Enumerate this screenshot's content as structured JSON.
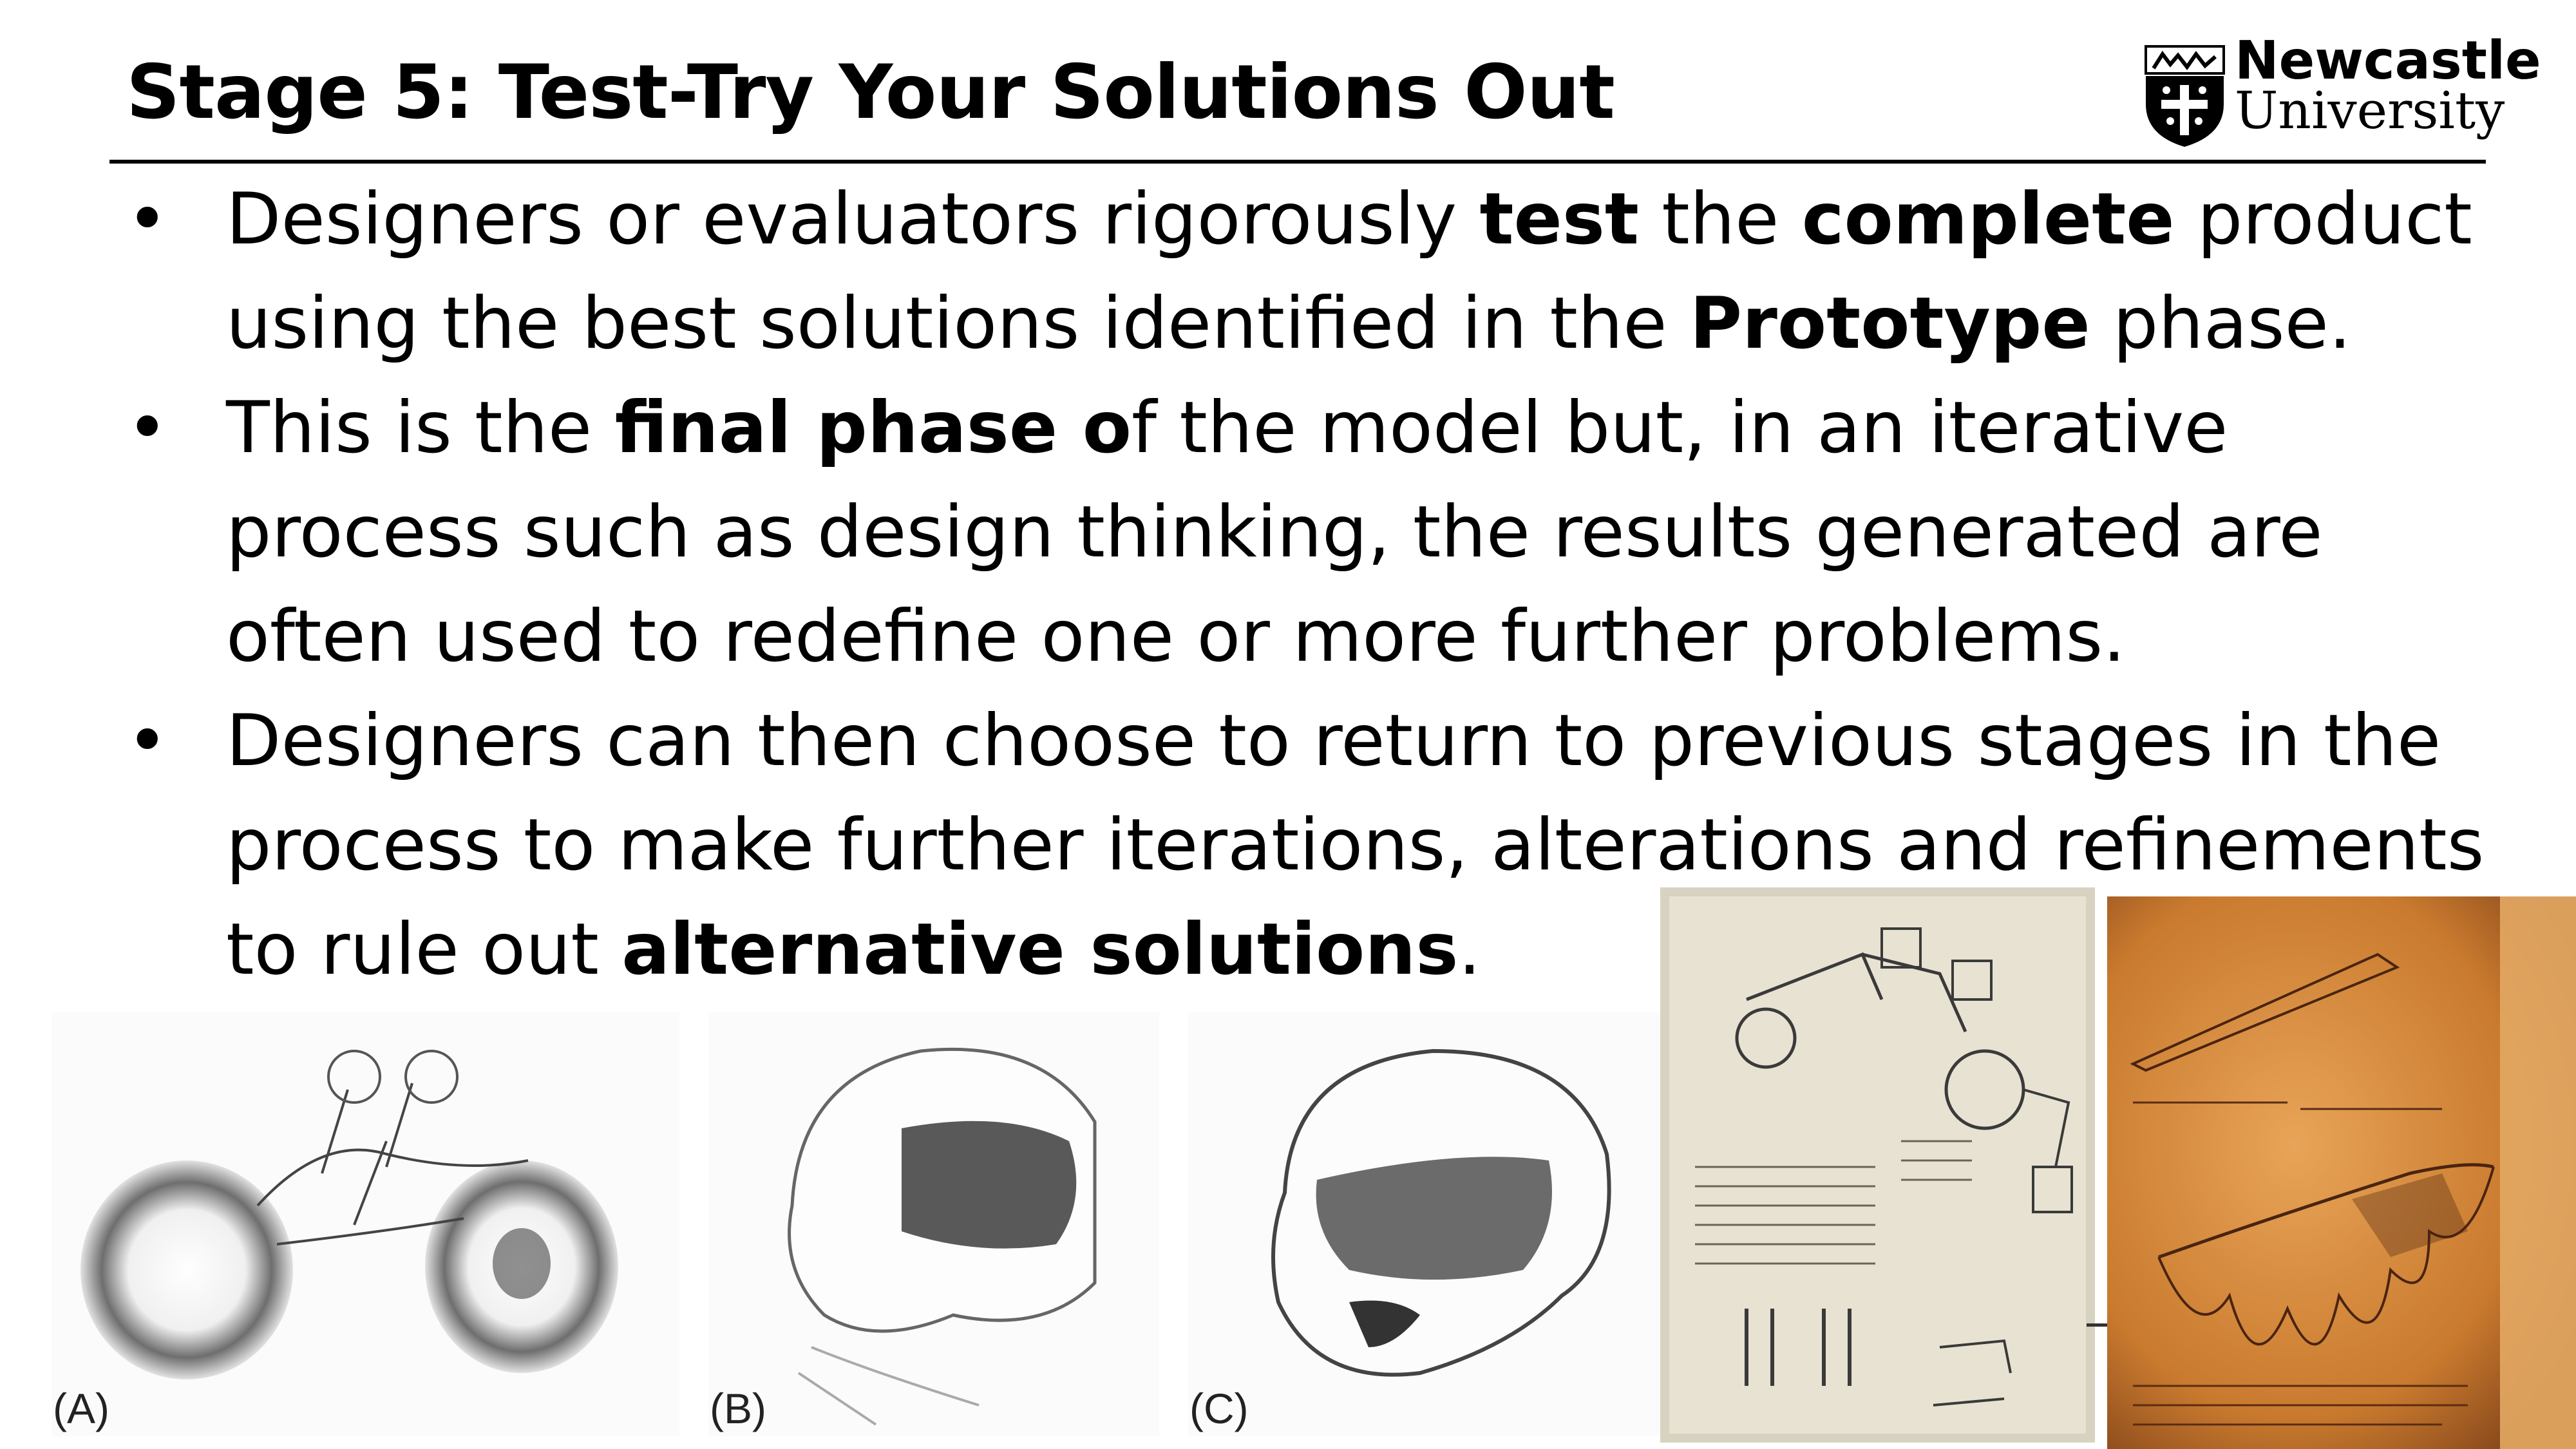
{
  "slide": {
    "title": "Stage 5: Test-Try Your Solutions Out",
    "logo": {
      "line1": "Newcastle",
      "line2": "University"
    },
    "bullets": [
      {
        "bullet": "•",
        "parts": [
          "Designers or evaluators rigorously ",
          "test",
          " the ",
          "complete",
          " product using the best solutions identified in the ",
          "Prototype",
          " phase."
        ]
      },
      {
        "bullet": "•",
        "parts": [
          "This is the ",
          "final phase o",
          "f the model but, in an iterative process such as design thinking, the results generated are often used to redefine one or more further problems."
        ]
      },
      {
        "bullet": "•",
        "parts": [
          "Designers can then choose to return to previous stages in the process to make further iterations, alterations and refinements to rule out ",
          "alternative solutions",
          "."
        ]
      }
    ],
    "figures": {
      "a_label": "(A)",
      "b_label": "(B)",
      "c_label": "(C)"
    }
  },
  "colors": {
    "text": "#000000",
    "parchment_light": "#e9e5d7",
    "parchment_dark": "#d8893c",
    "sketch_ink": "#3a3a3a"
  }
}
